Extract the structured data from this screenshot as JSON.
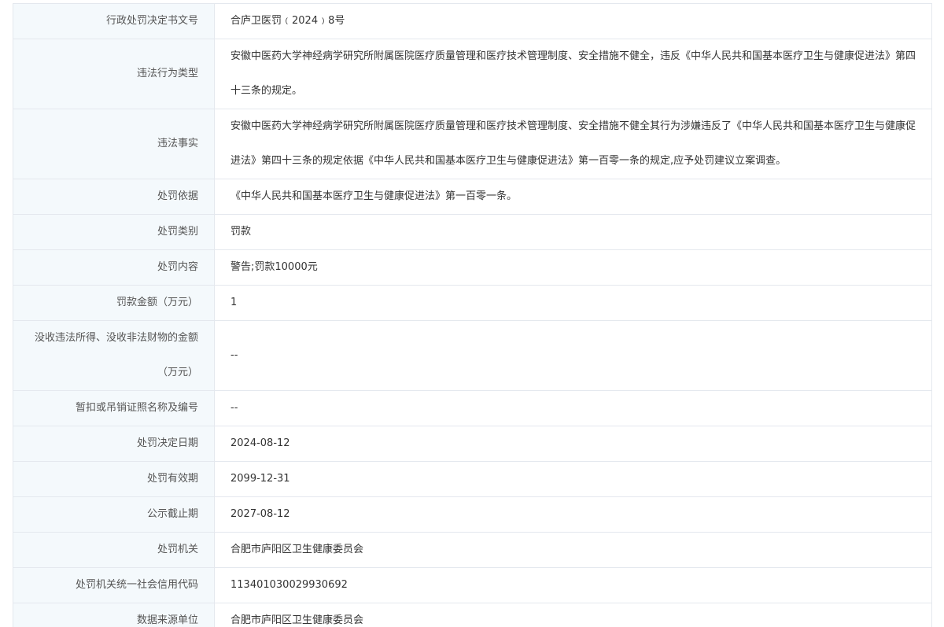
{
  "rows": [
    {
      "label": "行政处罚决定书文号",
      "value": "合庐卫医罚﹙2024﹚8号"
    },
    {
      "label": "违法行为类型",
      "value": "安徽中医药大学神经病学研究所附属医院医疗质量管理和医疗技术管理制度、安全措施不健全，违反《中华人民共和国基本医疗卫生与健康促进法》第四十三条的规定。"
    },
    {
      "label": "违法事实",
      "value": "安徽中医药大学神经病学研究所附属医院医疗质量管理和医疗技术管理制度、安全措施不健全其行为涉嫌违反了《中华人民共和国基本医疗卫生与健康促进法》第四十三条的规定依据《中华人民共和国基本医疗卫生与健康促进法》第一百零一条的规定,应予处罚建议立案调查。"
    },
    {
      "label": "处罚依据",
      "value": "《中华人民共和国基本医疗卫生与健康促进法》第一百零一条。"
    },
    {
      "label": "处罚类别",
      "value": "罚款"
    },
    {
      "label": "处罚内容",
      "value": "警告;罚款10000元"
    },
    {
      "label": "罚款金额（万元）",
      "value": "1"
    },
    {
      "label": "没收违法所得、没收非法财物的金额（万元）",
      "value": "--"
    },
    {
      "label": "暂扣或吊销证照名称及编号",
      "value": "--"
    },
    {
      "label": "处罚决定日期",
      "value": "2024-08-12"
    },
    {
      "label": "处罚有效期",
      "value": "2099-12-31"
    },
    {
      "label": "公示截止期",
      "value": "2027-08-12"
    },
    {
      "label": "处罚机关",
      "value": "合肥市庐阳区卫生健康委员会"
    },
    {
      "label": "处罚机关统一社会信用代码",
      "value": "113401030029930692"
    },
    {
      "label": "数据来源单位",
      "value": "合肥市庐阳区卫生健康委员会"
    }
  ]
}
